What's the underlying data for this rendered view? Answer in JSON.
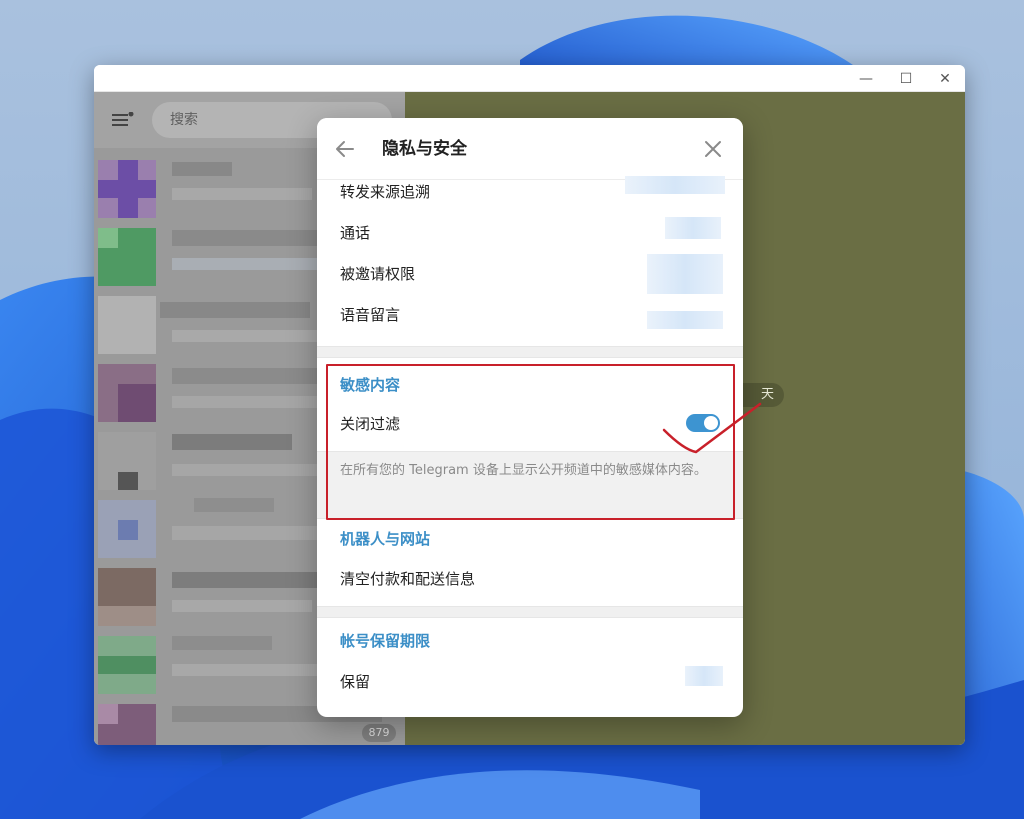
{
  "window": {
    "minimize_glyph": "—",
    "maximize_glyph": "☐",
    "close_glyph": "✕"
  },
  "sidebar": {
    "search_placeholder": "搜索",
    "unread_count": "879"
  },
  "chat": {
    "date_pill": "天"
  },
  "dialog": {
    "title": "隐私与安全",
    "rows_top": [
      {
        "label": "转发来源追溯"
      },
      {
        "label": "通话"
      },
      {
        "label": "被邀请权限"
      },
      {
        "label": "语音留言"
      }
    ],
    "sensitive": {
      "title": "敏感内容",
      "toggle_label": "关闭过滤",
      "toggle_on": true,
      "note": "在所有您的 Telegram 设备上显示公开频道中的敏感媒体内容。"
    },
    "bots": {
      "title": "机器人与网站",
      "row": "清空付款和配送信息"
    },
    "account": {
      "title": "帐号保留期限",
      "row": "保留"
    }
  },
  "colors": {
    "accent": "#3c8fc7",
    "toggle": "#3d94d1",
    "highlight": "#c8202a",
    "chat_bg": "#6a6e44"
  }
}
